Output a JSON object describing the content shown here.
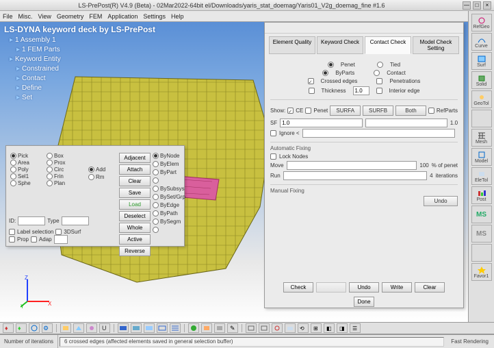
{
  "window": {
    "title": "LS-PrePost(R) V4.9 (Beta) - 02Mar2022-64bit el/Downloads/yaris_stat_doemag/Yaris01_V2g_doemag_fine #1.6",
    "min": "—",
    "max": "□",
    "close": "×"
  },
  "menu": [
    "File",
    "Misc.",
    "View",
    "Geometry",
    "FEM",
    "Application",
    "Settings",
    "Help"
  ],
  "tree": {
    "title": "LS-DYNA keyword deck by LS-PrePost",
    "items": [
      {
        "lvl": 1,
        "text": "1 Assembly 1"
      },
      {
        "lvl": 2,
        "text": "1 FEM Parts"
      },
      {
        "lvl": 1,
        "text": "Keyword Entity"
      },
      {
        "lvl": 2,
        "text": "Constrained"
      },
      {
        "lvl": 2,
        "text": "Contact"
      },
      {
        "lvl": 2,
        "text": "Define"
      },
      {
        "lvl": 2,
        "text": "Set"
      }
    ]
  },
  "sel": {
    "radios": [
      [
        "Pick",
        "Box"
      ],
      [
        "Area",
        "Prox"
      ],
      [
        "Poly",
        "Circ"
      ],
      [
        "Sel1",
        "Frin"
      ],
      [
        "Sphe",
        "Plan"
      ]
    ],
    "addrm": [
      "Add",
      "Rm"
    ],
    "midbtns": [
      "Adjacent",
      "Attach",
      "Clear",
      "Save",
      "Load",
      "Deselect",
      "Whole",
      "Active",
      "Reverse"
    ],
    "rightopts": [
      "ByNode",
      "ByElem",
      "ByPart",
      "",
      "BySubsys",
      "BySet/Grp",
      "ByEdge",
      "ByPath",
      "BySegm",
      ""
    ],
    "id_label": "ID:",
    "type_label": "Type",
    "label_sel": "Label selection",
    "sosurf": "3DSurf",
    "prop": "Prop",
    "adap": "Adap"
  },
  "mc": {
    "hdr": "",
    "tabs": [
      "Element Quality",
      "Keyword Check",
      "Contact Check",
      "Model Check Setting"
    ],
    "active_tab": 2,
    "opt1": [
      "Penet",
      "Tied"
    ],
    "opt2": [
      "ByParts",
      "Contact"
    ],
    "opt3": [
      "Crossed edges",
      "Penetrations"
    ],
    "opt4": [
      "Thickness",
      "",
      "Interior edge"
    ],
    "thick_val": "1.0",
    "show_label": "Show:",
    "show_opts": [
      "CE",
      "Penet",
      "SURFA",
      "SURFB",
      "Both",
      "RefParts"
    ],
    "sf_label": "SF",
    "sf_val": "1.0",
    "sf_max": "1.0",
    "ignore_label": "Ignore <",
    "ignore_max": "",
    "auto_title": "Automatic Fixing",
    "lock": "Lock Nodes",
    "move_label": "Move",
    "move_val": "",
    "move_max": "100",
    "move_unit": "% of penet",
    "run_label": "Run",
    "run_val": "",
    "run_max": "4",
    "run_unit": "iterations",
    "manual_title": "Manual Fixing",
    "undo": "Undo",
    "footer": [
      "Check",
      "",
      "Undo",
      "Write",
      "Clear"
    ],
    "done": "Done"
  },
  "rtool": [
    "RefGeo",
    "Curve",
    "Surf",
    "Solid",
    "GeoTol",
    "",
    "Mesh",
    "Model",
    "EleTol",
    "Post",
    "MS",
    "MS",
    "",
    "Favor1"
  ],
  "status": {
    "left": "Number of iterations",
    "mid": "6 crossed edges (affected elements saved in general selection buffer)",
    "right": "Fast Rendering"
  }
}
